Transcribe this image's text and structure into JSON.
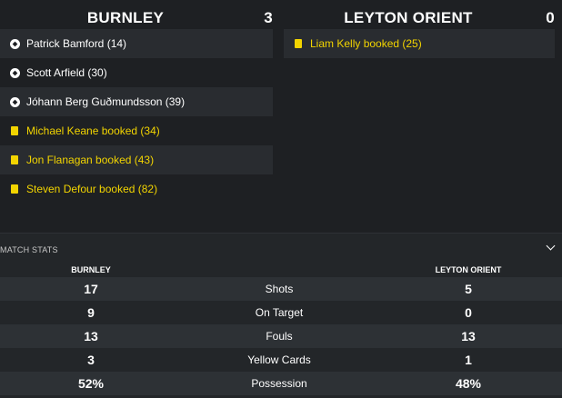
{
  "match": {
    "home": {
      "name": "BURNLEY",
      "score": "3"
    },
    "away": {
      "name": "LEYTON ORIENT",
      "score": "0"
    }
  },
  "home_events": [
    {
      "type": "goal",
      "icon": "ball-icon",
      "text": "Patrick Bamford (14)"
    },
    {
      "type": "goal",
      "icon": "ball-icon",
      "text": "Scott Arfield (30)"
    },
    {
      "type": "goal",
      "icon": "ball-icon",
      "text": "Jóhann Berg Guðmundsson (39)"
    },
    {
      "type": "booking",
      "icon": "yellow-card-icon",
      "text": "Michael Keane booked (34)"
    },
    {
      "type": "booking",
      "icon": "yellow-card-icon",
      "text": "Jon Flanagan booked (43)"
    },
    {
      "type": "booking",
      "icon": "yellow-card-icon",
      "text": "Steven Defour booked (82)"
    }
  ],
  "away_events": [
    {
      "type": "booking",
      "icon": "yellow-card-icon",
      "text": "Liam Kelly booked (25)"
    }
  ],
  "stats": {
    "title": "MATCH STATS",
    "home_label": "BURNLEY",
    "away_label": "LEYTON ORIENT",
    "rows": [
      {
        "label": "Shots",
        "home": "17",
        "away": "5"
      },
      {
        "label": "On Target",
        "home": "9",
        "away": "0"
      },
      {
        "label": "Fouls",
        "home": "13",
        "away": "13"
      },
      {
        "label": "Yellow Cards",
        "home": "3",
        "away": "1"
      },
      {
        "label": "Possession",
        "home": "52%",
        "away": "48%"
      }
    ]
  },
  "colors": {
    "background": "#1e2023",
    "row_shade": "#292c30",
    "stats_panel": "#232629",
    "stats_row_shade": "#2d3135",
    "yellow": "#f2d400",
    "text": "#ffffff"
  }
}
